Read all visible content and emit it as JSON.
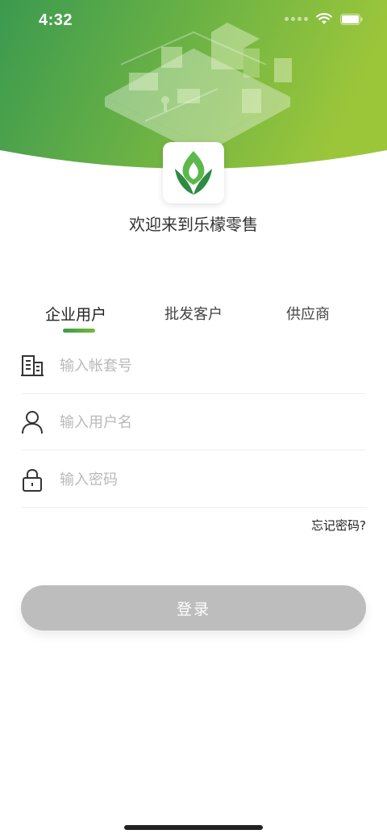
{
  "status_bar": {
    "time": "4:32"
  },
  "header": {
    "welcome_text": "欢迎来到乐檬零售"
  },
  "tabs": [
    {
      "label": "企业用户",
      "active": true
    },
    {
      "label": "批发客户",
      "active": false
    },
    {
      "label": "供应商",
      "active": false
    }
  ],
  "form": {
    "account": {
      "placeholder": "输入帐套号",
      "icon": "building-icon",
      "value": ""
    },
    "username": {
      "placeholder": "输入用户名",
      "icon": "user-icon",
      "value": ""
    },
    "password": {
      "placeholder": "输入密码",
      "icon": "lock-icon",
      "value": ""
    },
    "forgot_label": "忘记密码?"
  },
  "login_button": {
    "label": "登录"
  },
  "colors": {
    "accent_green": "#4aa44f",
    "banner_start": "#3f9d4e",
    "banner_end": "#9cc63a",
    "button_disabled": "#bdbdbd"
  }
}
